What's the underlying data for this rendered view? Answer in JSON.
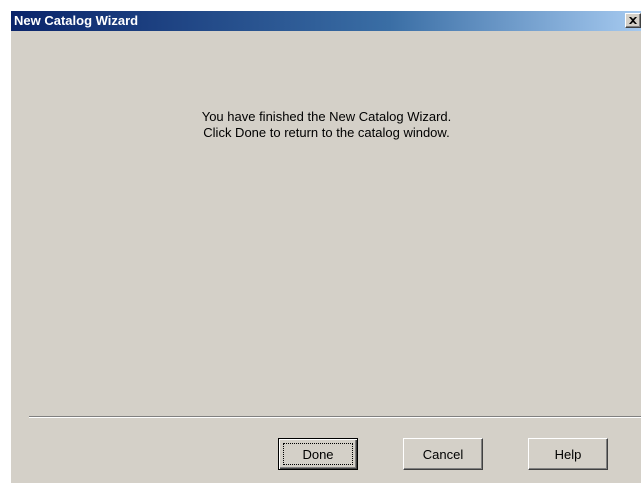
{
  "window": {
    "title": "New Catalog Wizard",
    "close_icon": "close-icon"
  },
  "content": {
    "message_line1": "You have finished the New Catalog Wizard.",
    "message_line2": "Click Done to return to the catalog window."
  },
  "buttons": {
    "done_label": "Done",
    "cancel_label": "Cancel",
    "help_label": "Help"
  },
  "colors": {
    "title_bar_start": "#0a246a",
    "title_bar_end": "#a6caf0",
    "dialog_background": "#d4d0c8"
  }
}
